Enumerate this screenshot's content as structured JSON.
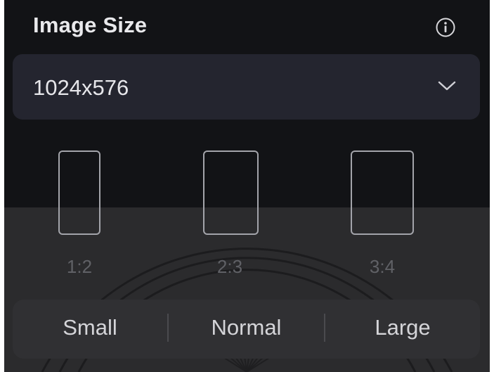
{
  "header": {
    "title": "Image Size",
    "info_icon": "info-circle-icon"
  },
  "size_select": {
    "value": "1024x576",
    "chevron_icon": "chevron-down-icon"
  },
  "aspect_ratios": [
    {
      "label": "1:2"
    },
    {
      "label": "2:3"
    },
    {
      "label": "3:4"
    }
  ],
  "quality": {
    "options": [
      {
        "label": "Small"
      },
      {
        "label": "Normal"
      },
      {
        "label": "Large"
      }
    ]
  },
  "colors": {
    "background": "#121316",
    "select_bg": "#24252f",
    "text": "#e6e6ea",
    "muted": "#606166"
  }
}
